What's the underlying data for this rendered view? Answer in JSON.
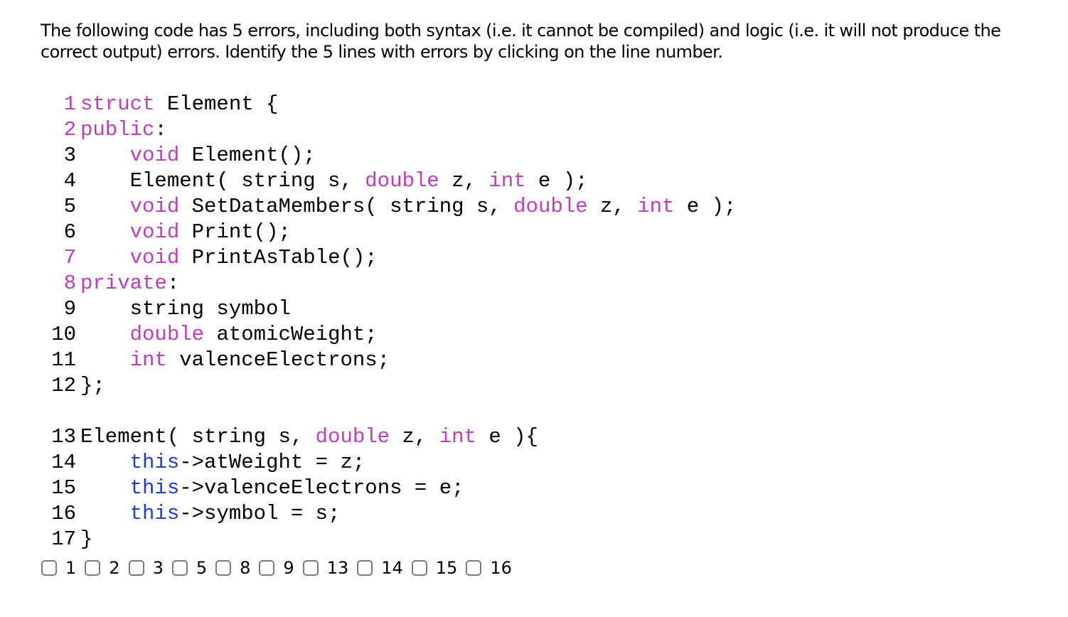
{
  "prompt": "The following code has 5 errors, including both syntax (i.e. it cannot be compiled) and logic (i.e. it will not produce the correct output) errors. Identify the 5 lines with errors by clicking on the line number.",
  "colors": {
    "keyword": "#c03bc0",
    "this_keyword": "#1c3fd1",
    "text": "#000000",
    "checkbox_border": "#7a7a7a"
  },
  "code_block_1": [
    {
      "num": "1",
      "tokens": [
        [
          "kw",
          "struct"
        ],
        [
          "t",
          " Element {"
        ]
      ]
    },
    {
      "num": "2",
      "tokens": [
        [
          "kw",
          "public"
        ],
        [
          "t",
          ":"
        ]
      ]
    },
    {
      "num": "3",
      "tokens": [
        [
          "t",
          "    "
        ],
        [
          "kw",
          "void"
        ],
        [
          "t",
          " Element();"
        ]
      ]
    },
    {
      "num": "4",
      "tokens": [
        [
          "t",
          "    Element( string s, "
        ],
        [
          "kw",
          "double"
        ],
        [
          "t",
          " z, "
        ],
        [
          "kw",
          "int"
        ],
        [
          "t",
          " e );"
        ]
      ]
    },
    {
      "num": "5",
      "tokens": [
        [
          "t",
          "    "
        ],
        [
          "kw",
          "void"
        ],
        [
          "t",
          " SetDataMembers( string s, "
        ],
        [
          "kw",
          "double"
        ],
        [
          "t",
          " z, "
        ],
        [
          "kw",
          "int"
        ],
        [
          "t",
          " e );"
        ]
      ]
    },
    {
      "num": "6",
      "tokens": [
        [
          "t",
          "    "
        ],
        [
          "kw",
          "void"
        ],
        [
          "t",
          " Print();"
        ]
      ]
    },
    {
      "num": "7",
      "tokens": [
        [
          "t",
          "    "
        ],
        [
          "kw",
          "void"
        ],
        [
          "t",
          " PrintAsTable();"
        ]
      ]
    },
    {
      "num": "8",
      "tokens": [
        [
          "kw",
          "private"
        ],
        [
          "t",
          ":"
        ]
      ]
    },
    {
      "num": "9",
      "tokens": [
        [
          "t",
          "    string symbol"
        ]
      ]
    },
    {
      "num": "10",
      "tokens": [
        [
          "t",
          "    "
        ],
        [
          "kw",
          "double"
        ],
        [
          "t",
          " atomicWeight;"
        ]
      ]
    },
    {
      "num": "11",
      "tokens": [
        [
          "t",
          "    "
        ],
        [
          "kw",
          "int"
        ],
        [
          "t",
          " valenceElectrons;"
        ]
      ]
    },
    {
      "num": "12",
      "tokens": [
        [
          "t",
          "};"
        ]
      ]
    }
  ],
  "purple_line_numbers": [
    "1",
    "2",
    "7",
    "8"
  ],
  "code_block_2": [
    {
      "num": "13",
      "tokens": [
        [
          "t",
          "Element( string s, "
        ],
        [
          "kw",
          "double"
        ],
        [
          "t",
          " z, "
        ],
        [
          "kw",
          "int"
        ],
        [
          "t",
          " e ){"
        ]
      ]
    },
    {
      "num": "14",
      "tokens": [
        [
          "t",
          "    "
        ],
        [
          "this",
          "this"
        ],
        [
          "t",
          "->atWeight = z;"
        ]
      ]
    },
    {
      "num": "15",
      "tokens": [
        [
          "t",
          "    "
        ],
        [
          "this",
          "this"
        ],
        [
          "t",
          "->valenceElectrons = e;"
        ]
      ]
    },
    {
      "num": "16",
      "tokens": [
        [
          "t",
          "    "
        ],
        [
          "this",
          "this"
        ],
        [
          "t",
          "->symbol = s;"
        ]
      ]
    },
    {
      "num": "17",
      "tokens": [
        [
          "t",
          "}"
        ]
      ]
    }
  ],
  "answer_options": [
    "1",
    "2",
    "3",
    "5",
    "8",
    "9",
    "13",
    "14",
    "15",
    "16"
  ]
}
